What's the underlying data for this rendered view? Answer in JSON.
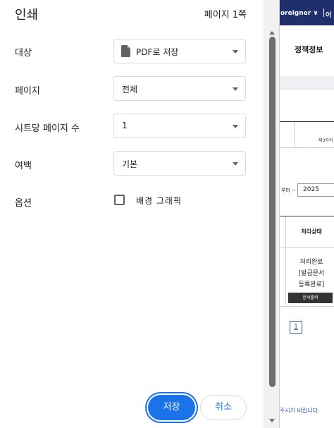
{
  "dialog": {
    "title": "인쇄",
    "page_count": "페이지 1쪽",
    "rows": {
      "destination": {
        "label": "대상",
        "value": "PDF로 저장",
        "icon": "document-icon"
      },
      "pages": {
        "label": "페이지",
        "value": "전체"
      },
      "pages_per_sheet": {
        "label": "시트당 페이지 수",
        "value": "1"
      },
      "margins": {
        "label": "여백",
        "value": "기본"
      },
      "options": {
        "label": "옵션",
        "checkbox_label": "배경 그래픽",
        "checked": false
      }
    },
    "buttons": {
      "save": "저장",
      "cancel": "취소"
    }
  },
  "preview": {
    "header_brand": "oreigner",
    "header_chevron": "∨",
    "header_lang": "어",
    "title": "정책정보",
    "col_header_small": "제3자의",
    "date_label": "부터 ~",
    "date_value": "2025",
    "table_header": "처리상태",
    "status_lines": [
      "처리완료",
      "[발급문서",
      "등록완료]"
    ],
    "print_button": "문서출력",
    "page_number": "1",
    "footer_text": "주시기 바랍니다."
  },
  "colors": {
    "accent": "#1a73e8",
    "preview_header": "#1f2f6b",
    "link_blue": "#2b5cb0"
  }
}
